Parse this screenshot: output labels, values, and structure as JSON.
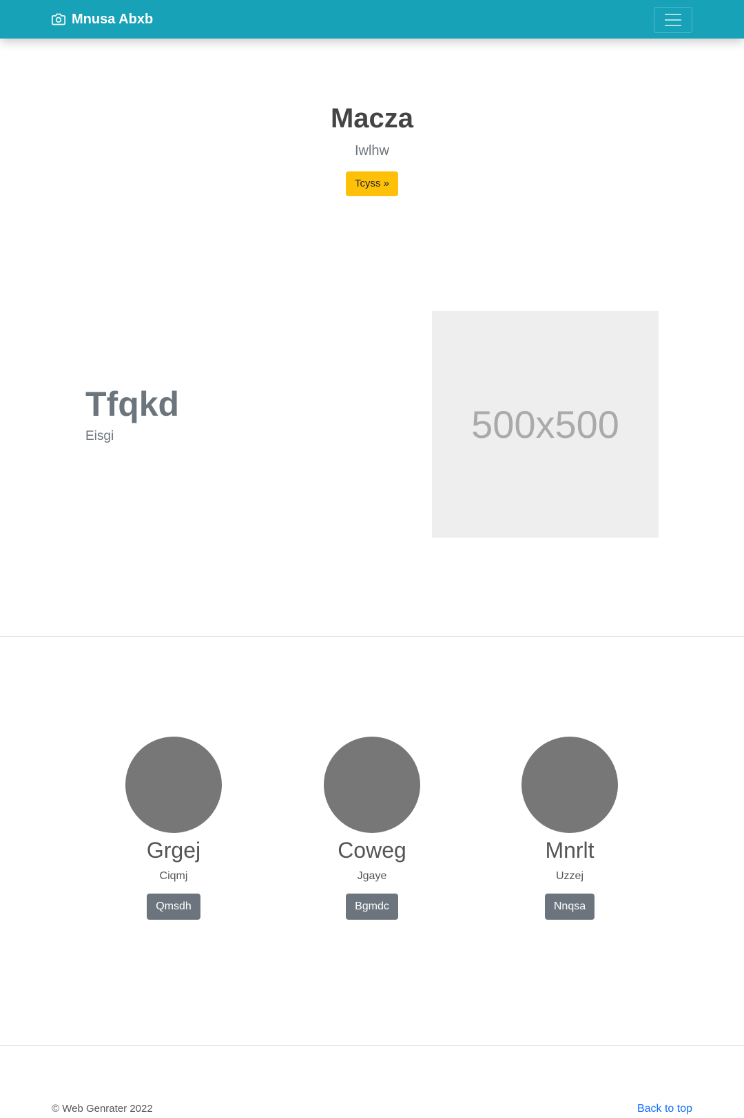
{
  "navbar": {
    "brand": "Mnusa Abxb",
    "brand_icon": "camera-icon",
    "toggler_icon": "hamburger-menu-icon",
    "background": "#17a2b8"
  },
  "hero": {
    "title": "Macza",
    "subtitle": "Iwlhw",
    "button": "Tcyss »",
    "button_color": "#ffc107"
  },
  "feature": {
    "title": "Tfqkd",
    "subtitle": "Eisgi",
    "image_placeholder": "500x500"
  },
  "team": [
    {
      "name": "Grgej",
      "role": "Ciqmj",
      "button": "Qmsdh"
    },
    {
      "name": "Coweg",
      "role": "Jgaye",
      "button": "Bgmdc"
    },
    {
      "name": "Mnrlt",
      "role": "Uzzej",
      "button": "Nnqsa"
    }
  ],
  "footer": {
    "copyright": "© Web Genrater 2022",
    "back_to_top": "Back to top"
  }
}
